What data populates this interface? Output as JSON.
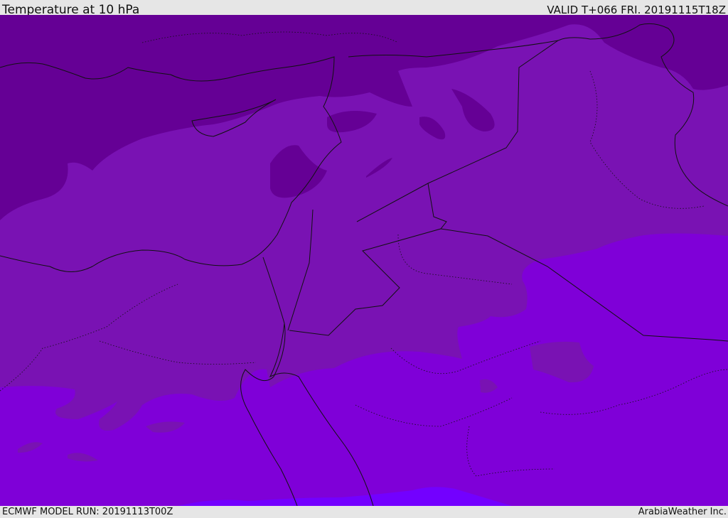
{
  "header": {
    "title": "Temperature at 10 hPa",
    "valid": "VALID T+066 FRI. 20191115T18Z"
  },
  "footer": {
    "model_run": "ECMWF MODEL RUN: 20191113T00Z",
    "credit": "ArabiaWeather Inc."
  },
  "map": {
    "region": "Eastern Mediterranean / Middle East",
    "field": "temperature",
    "level": "10 hPa",
    "band_colors": [
      "#650095",
      "#7912b3",
      "#7f00d8",
      "#7300ff"
    ]
  }
}
